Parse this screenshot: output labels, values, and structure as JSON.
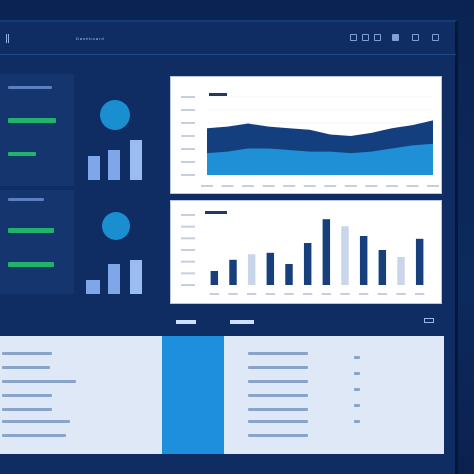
{
  "window": {
    "title": "Dashboard"
  },
  "header": {
    "breadcrumb": "",
    "title": ""
  },
  "tabs": [],
  "chart_main": {
    "title": "",
    "type": "area"
  },
  "chart_data": [
    {
      "type": "area",
      "title": "",
      "categories": [
        "1",
        "2",
        "3",
        "4",
        "5",
        "6",
        "7",
        "8",
        "9",
        "10",
        "11",
        "12"
      ],
      "series": [
        {
          "values": [
            60,
            62,
            66,
            62,
            60,
            58,
            52,
            50,
            54,
            60,
            64,
            70
          ]
        },
        {
          "values": [
            28,
            30,
            34,
            34,
            32,
            30,
            30,
            28,
            30,
            34,
            38,
            40
          ]
        }
      ],
      "ylim": [
        0,
        100
      ]
    },
    {
      "type": "bar",
      "title": "",
      "categories": [
        "1",
        "2",
        "3",
        "4",
        "5",
        "6",
        "7",
        "8",
        "9",
        "10",
        "11",
        "12"
      ],
      "series": [
        {
          "values": [
            20,
            36,
            44,
            46,
            30,
            60,
            94,
            84,
            70,
            50,
            40,
            66
          ]
        }
      ],
      "ylim": [
        0,
        100
      ]
    }
  ]
}
